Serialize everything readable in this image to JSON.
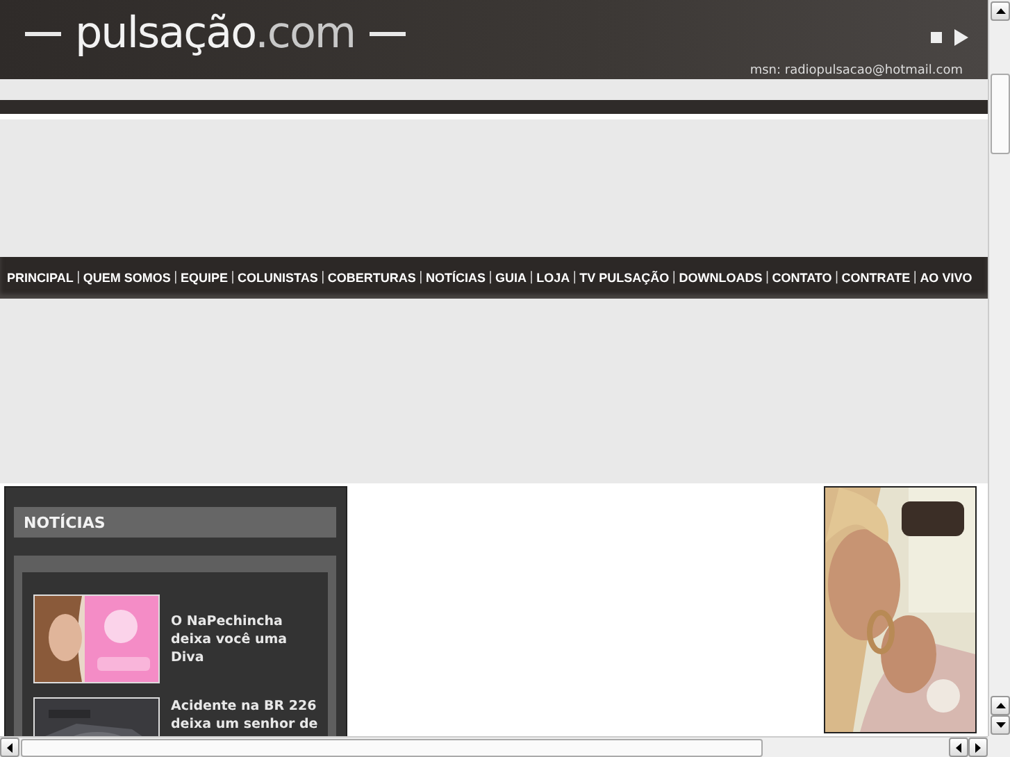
{
  "header": {
    "logo": "pulsação",
    "logo_suffix": ".com",
    "contact": "msn: radiopulsacao@hotmail.com"
  },
  "nav": [
    {
      "label": "PRINCIPAL",
      "separator": "|"
    },
    {
      "label": "QUEM SOMOS",
      "separator": "|"
    },
    {
      "label": "EQUIPE",
      "separator": "|"
    },
    {
      "label": "COLUNISTAS",
      "separator": "|"
    },
    {
      "label": "COBERTURAS",
      "separator": "|"
    },
    {
      "label": "NOTÍCIAS",
      "separator": "|"
    },
    {
      "label": "GUIA",
      "separator": "|"
    },
    {
      "label": "LOJA",
      "separator": "|"
    },
    {
      "label": "TV PULSAÇÃO",
      "separator": "|"
    },
    {
      "label": "DOWNLOADS",
      "separator": "|"
    },
    {
      "label": "CONTATO",
      "separator": "|"
    },
    {
      "label": "CONTRATE",
      "separator": "|"
    },
    {
      "label": "AO VIVO"
    }
  ],
  "news": {
    "title": "NOTÍCIAS",
    "items": [
      {
        "headline": "O NaPechincha deixa você uma Diva",
        "kind": "pink"
      },
      {
        "headline": "Acidente na BR 226 deixa um senhor de",
        "kind": "dark"
      }
    ]
  }
}
